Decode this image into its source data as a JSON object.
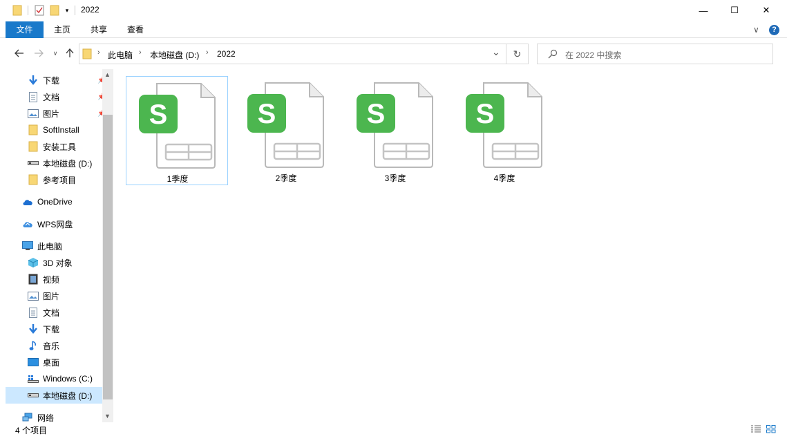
{
  "window": {
    "title": "2022",
    "minimize_glyph": "—",
    "maximize_glyph": "☐",
    "close_glyph": "✕"
  },
  "ribbon": {
    "tabs": [
      "文件",
      "主页",
      "共享",
      "查看"
    ],
    "collapse_glyph": "∨",
    "help_glyph": "?"
  },
  "address": {
    "crumbs": [
      "此电脑",
      "本地磁盘 (D:)",
      "2022"
    ],
    "separator": "›",
    "dropdown_glyph": "⌄",
    "refresh_glyph": "↻"
  },
  "search": {
    "placeholder": "在 2022 中搜索"
  },
  "sidebar": {
    "quick_access": [
      {
        "label": "下载",
        "icon": "download-icon",
        "pinned": true
      },
      {
        "label": "文档",
        "icon": "document-icon",
        "pinned": true
      },
      {
        "label": "图片",
        "icon": "picture-icon",
        "pinned": true
      },
      {
        "label": "SoftInstall",
        "icon": "folder-icon",
        "pinned": false
      },
      {
        "label": "安装工具",
        "icon": "folder-icon",
        "pinned": false
      },
      {
        "label": "本地磁盘 (D:)",
        "icon": "drive-icon",
        "pinned": false
      },
      {
        "label": "参考项目",
        "icon": "folder-icon",
        "pinned": false
      }
    ],
    "onedrive": "OneDrive",
    "wps": "WPS网盘",
    "this_pc": "此电脑",
    "pc_items": [
      {
        "label": "3D 对象",
        "icon": "3d-objects-icon"
      },
      {
        "label": "视频",
        "icon": "video-icon"
      },
      {
        "label": "图片",
        "icon": "picture-icon"
      },
      {
        "label": "文档",
        "icon": "document-icon"
      },
      {
        "label": "下载",
        "icon": "download-icon"
      },
      {
        "label": "音乐",
        "icon": "music-icon"
      },
      {
        "label": "桌面",
        "icon": "desktop-icon"
      },
      {
        "label": "Windows (C:)",
        "icon": "windows-drive-icon"
      },
      {
        "label": "本地磁盘 (D:)",
        "icon": "drive-icon",
        "selected": true
      }
    ],
    "network": "网络"
  },
  "files": [
    {
      "name": "1季度",
      "icon": "wps-spreadsheet-icon",
      "selected": true
    },
    {
      "name": "2季度",
      "icon": "wps-spreadsheet-icon",
      "selected": false
    },
    {
      "name": "3季度",
      "icon": "wps-spreadsheet-icon",
      "selected": false
    },
    {
      "name": "4季度",
      "icon": "wps-spreadsheet-icon",
      "selected": false
    }
  ],
  "status": {
    "item_count": "4 个项目"
  },
  "colors": {
    "accent": "#1979ca",
    "selection": "#cce8ff",
    "wps_green": "#4cb64f",
    "folder": "#f8d775"
  }
}
